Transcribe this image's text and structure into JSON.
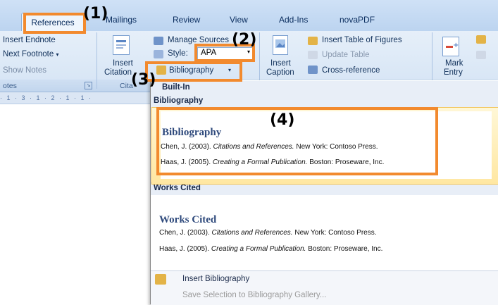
{
  "tabs": {
    "references": "References",
    "mailings": "Mailings",
    "review": "Review",
    "view": "View",
    "addins": "Add-Ins",
    "novapdf": "novaPDF"
  },
  "ribbon": {
    "insert_endnote": "Insert Endnote",
    "next_footnote": "Next Footnote",
    "show_notes": "Show Notes",
    "footnotes_group": "otes",
    "insert_citation": "Insert",
    "insert_citation_2": "Citation",
    "manage_sources": "Manage Sources",
    "style_label": "Style:",
    "style_value": "APA",
    "bibliography": "Bibliography",
    "citations_group": "Cita",
    "insert_caption": "Insert",
    "insert_caption_2": "Caption",
    "insert_table_of_figures": "Insert Table of Figures",
    "update_table": "Update Table",
    "cross_reference": "Cross-reference",
    "mark_entry": "Mark",
    "mark_entry_2": "Entry"
  },
  "ruler_text": "· 1 · 3 · 1 · 2 · 1 · 1 ·",
  "dropdown": {
    "builtin": "Built-In",
    "bibliography_head": "Bibliography",
    "bibliography_title": "Bibliography",
    "works_cited_head": "Works Cited",
    "works_cited_title": "Works Cited",
    "citations": [
      {
        "prefix": "Chen, J. (2003). ",
        "title": "Citations and References.",
        "suffix": " New York: Contoso Press."
      },
      {
        "prefix": "Haas, J. (2005). ",
        "title": "Creating a Formal Publication.",
        "suffix": " Boston: Proseware, Inc."
      }
    ],
    "insert_bibliography": "Insert Bibliography",
    "save_selection": "Save Selection to Bibliography Gallery..."
  },
  "callouts": {
    "c1": "(1)",
    "c2": "(2)",
    "c3": "(3)",
    "c4": "(4)"
  },
  "colors": {
    "callout": "#f28a2e",
    "highlight": "#ffe7a2"
  }
}
